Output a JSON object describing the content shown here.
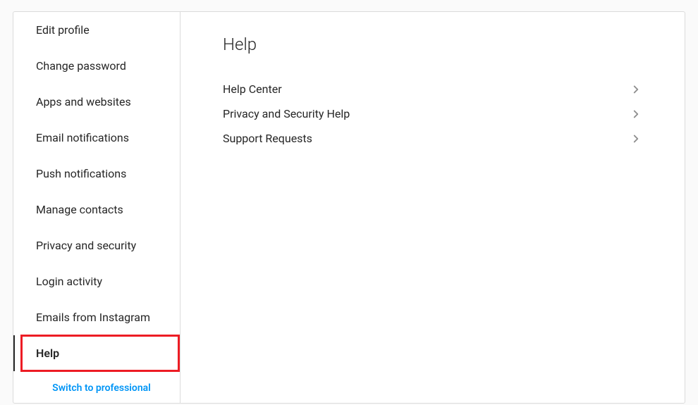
{
  "sidebar": {
    "items": [
      {
        "label": "Edit profile"
      },
      {
        "label": "Change password"
      },
      {
        "label": "Apps and websites"
      },
      {
        "label": "Email notifications"
      },
      {
        "label": "Push notifications"
      },
      {
        "label": "Manage contacts"
      },
      {
        "label": "Privacy and security"
      },
      {
        "label": "Login activity"
      },
      {
        "label": "Emails from Instagram"
      },
      {
        "label": "Help"
      }
    ],
    "switch_link": "Switch to professional"
  },
  "main": {
    "title": "Help",
    "help_items": [
      {
        "label": "Help Center"
      },
      {
        "label": "Privacy and Security Help"
      },
      {
        "label": "Support Requests"
      }
    ]
  }
}
